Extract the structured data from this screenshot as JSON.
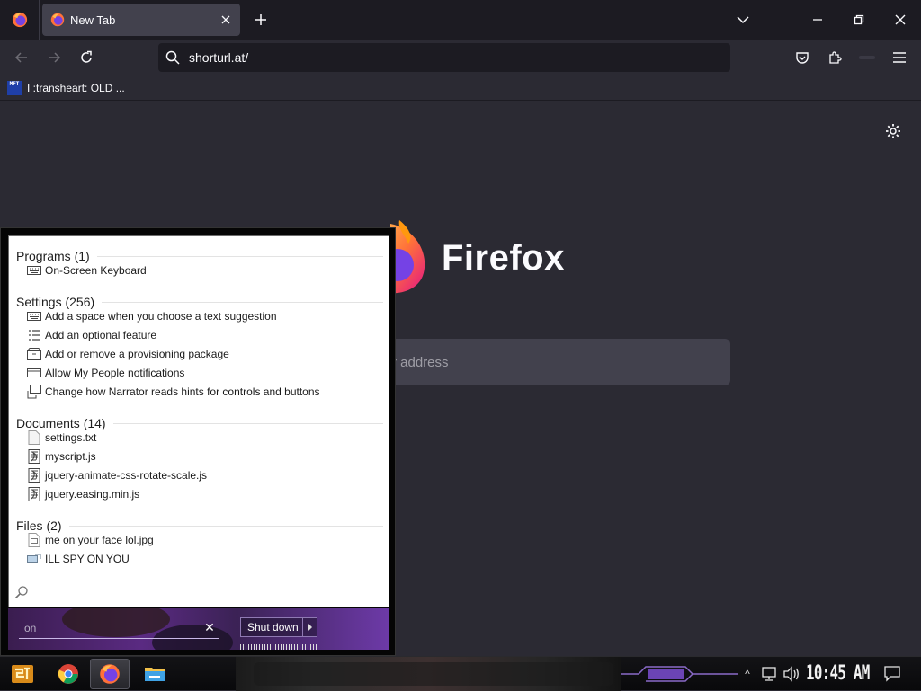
{
  "browser": {
    "tab": {
      "title": "New Tab"
    },
    "url": "shorturl.at/",
    "bookmark": {
      "label": "I :transheart: OLD ...",
      "favicon_text": "MFT"
    },
    "brand": "Firefox",
    "search_placeholder": "r address"
  },
  "start_menu": {
    "groups": [
      {
        "title": "Programs (1)",
        "items": [
          {
            "label": "On-Screen Keyboard",
            "icon": "keyboard-icon"
          }
        ]
      },
      {
        "title": "Settings (256)",
        "items": [
          {
            "label": "Add a space when you choose a text suggestion",
            "icon": "keyboard-icon"
          },
          {
            "label": "Add an optional feature",
            "icon": "list-icon"
          },
          {
            "label": "Add or remove a provisioning package",
            "icon": "package-icon"
          },
          {
            "label": "Allow My People notifications",
            "icon": "window-icon"
          },
          {
            "label": "Change how Narrator reads hints for controls and buttons",
            "icon": "narrator-icon"
          }
        ]
      },
      {
        "title": "Documents (14)",
        "items": [
          {
            "label": "settings.txt",
            "icon": "text-file-icon"
          },
          {
            "label": "myscript.js",
            "icon": "script-file-icon"
          },
          {
            "label": "jquery-animate-css-rotate-scale.js",
            "icon": "script-file-icon"
          },
          {
            "label": "jquery.easing.min.js",
            "icon": "script-file-icon"
          }
        ]
      },
      {
        "title": "Files (2)",
        "items": [
          {
            "label": "me on your face lol.jpg",
            "icon": "image-file-icon"
          },
          {
            "label": "ILL SPY ON YOU",
            "icon": "shortcut-icon"
          }
        ]
      }
    ],
    "search_value": "on",
    "shutdown_label": "Shut down"
  },
  "taskbar": {
    "clock": "10:45 AM"
  }
}
